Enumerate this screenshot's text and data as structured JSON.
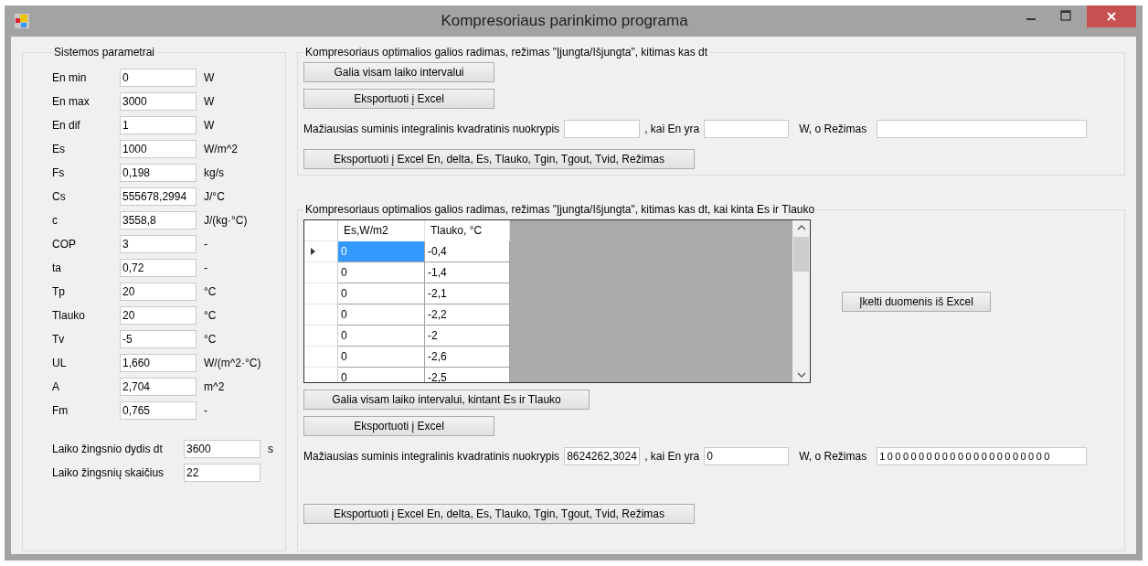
{
  "window": {
    "title": "Kompresoriaus parinkimo programa"
  },
  "params": {
    "title": "Sistemos parametrai",
    "rows": [
      {
        "label": "En min",
        "value": "0",
        "unit": "W"
      },
      {
        "label": "En max",
        "value": "3000",
        "unit": "W"
      },
      {
        "label": "En dif",
        "value": "1",
        "unit": "W"
      },
      {
        "label": "Es",
        "value": "1000",
        "unit": "W/m^2"
      },
      {
        "label": "Fs",
        "value": "0,198",
        "unit": "kg/s"
      },
      {
        "label": "Cs",
        "value": "555678,2994",
        "unit": "J/°C"
      },
      {
        "label": "c",
        "value": "3558,8",
        "unit": "J/(kg·°C)"
      },
      {
        "label": "COP",
        "value": "3",
        "unit": "-"
      },
      {
        "label": "ta",
        "value": "0,72",
        "unit": "-"
      },
      {
        "label": "Tp",
        "value": "20",
        "unit": "°C"
      },
      {
        "label": "Tlauko",
        "value": "20",
        "unit": "°C"
      },
      {
        "label": "Tv",
        "value": "-5",
        "unit": "°C"
      },
      {
        "label": "UL",
        "value": "1,660",
        "unit": "W/(m^2·°C)"
      },
      {
        "label": "A",
        "value": "2,704",
        "unit": "m^2"
      },
      {
        "label": "Fm",
        "value": "0,765",
        "unit": "-"
      }
    ],
    "steps": [
      {
        "label": "Laiko žingsnio dydis dt",
        "value": "3600",
        "unit": "s"
      },
      {
        "label": "Laiko žingsnių skaičius",
        "value": "22"
      }
    ]
  },
  "section_1": {
    "title": "Kompresoriaus optimalios galios radimas, režimas \"Įjungta/Išjungta\", kitimas kas dt",
    "buttons": [
      "Galia visam laiko intervalui",
      "Eksportuoti į Excel"
    ],
    "result": {
      "label": "Mažiausias suminis integralinis kvadratinis nuokrypis",
      "en_label": ", kai En yra",
      "mode_label": "W, o Režimas"
    },
    "export_button": "Eksportuoti į Excel En, delta, Es, Tlauko, Tgin, Tgout, Tvid, Režimas"
  },
  "section_2": {
    "title": "Kompresoriaus optimalios galios radimas, režimas \"Įjungta/Išjungta\", kitimas kas dt, kai kinta Es ir Tlauko",
    "table": {
      "columns": [
        "Es,W/m2",
        "Tlauko, °C"
      ],
      "rows": [
        {
          "selected": true,
          "cells": [
            "0",
            "-0,4"
          ]
        },
        {
          "selected": false,
          "cells": [
            "0",
            "-1,4"
          ]
        },
        {
          "selected": false,
          "cells": [
            "0",
            "-2,1"
          ]
        },
        {
          "selected": false,
          "cells": [
            "0",
            "-2,2"
          ]
        },
        {
          "selected": false,
          "cells": [
            "0",
            "-2"
          ]
        },
        {
          "selected": false,
          "cells": [
            "0",
            "-2,6"
          ]
        },
        {
          "selected": false,
          "cells": [
            "0",
            "-2,5"
          ]
        }
      ]
    },
    "load_button": "Įkelti duomenis iš Excel",
    "buttons": [
      "Galia visam laiko intervalui, kintant Es ir Tlauko",
      "Eksportuoti į Excel"
    ],
    "result": {
      "label": "Mažiausias suminis integralinis kvadratinis nuokrypis",
      "value": "8624262,3024",
      "en_label": ", kai En yra",
      "en_value": "0",
      "mode_label": "W, o Režimas",
      "mode_value": "1 0 0 0 0 0 0 0 0 0 0 0 0 0 0 0 0 0 0 0 0 0"
    },
    "export_button": "Eksportuoti į Excel En, delta, Es, Tlauko, Tgin, Tgout, Tvid, Režimas"
  }
}
